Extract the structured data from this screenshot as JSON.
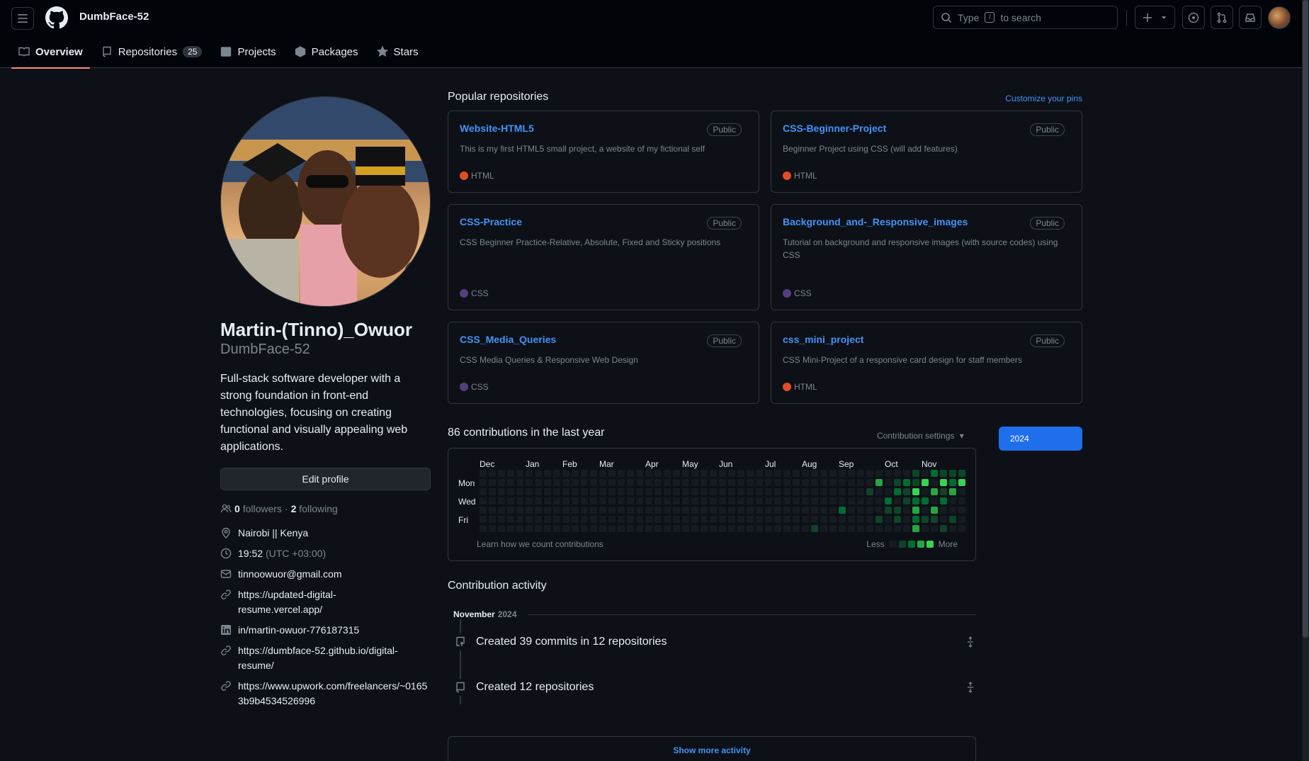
{
  "header": {
    "username": "DumbFace-52",
    "search_prefix": "Type",
    "search_key": "/",
    "search_suffix": "to search"
  },
  "tabs": [
    {
      "label": "Overview"
    },
    {
      "label": "Repositories",
      "count": "25"
    },
    {
      "label": "Projects"
    },
    {
      "label": "Packages"
    },
    {
      "label": "Stars"
    }
  ],
  "profile": {
    "fullname": "Martin-(Tinno)_Owuor",
    "login": "DumbFace-52",
    "bio": "Full-stack software developer with a strong foundation in front-end technologies, focusing on creating functional and visually appealing web applications.",
    "edit_label": "Edit profile",
    "followers_count": "0",
    "followers_label": "followers",
    "separator": "·",
    "following_count": "2",
    "following_label": "following",
    "location": "Nairobi || Kenya",
    "time": "19:52",
    "timezone": "(UTC +03:00)",
    "email": "tinnoowuor@gmail.com",
    "link1": "https://updated-digital-resume.vercel.app/",
    "linkedin": "in/martin-owuor-776187315",
    "link2": "https://dumbface-52.github.io/digital-resume/",
    "link3": "https://www.upwork.com/freelancers/~01653b9b4534526996"
  },
  "popular": {
    "title": "Popular repositories",
    "customize": "Customize your pins",
    "badge": "Public",
    "repos": [
      {
        "name": "Website-HTML5",
        "desc": "This is my first HTML5 small project, a website of my fictional self",
        "lang": "HTML",
        "color": "#e34c26"
      },
      {
        "name": "CSS-Beginner-Project",
        "desc": "Beginner Project using CSS (will add features)",
        "lang": "HTML",
        "color": "#e34c26"
      },
      {
        "name": "CSS-Practice",
        "desc": "CSS Beginner Practice-Relative, Absolute, Fixed and Sticky positions",
        "lang": "CSS",
        "color": "#563d7c"
      },
      {
        "name": "Background_and-_Responsive_images",
        "desc": "Tutorial on background and responsive images (with source codes) using CSS",
        "lang": "CSS",
        "color": "#563d7c"
      },
      {
        "name": "CSS_Media_Queries",
        "desc": "CSS Media Queries & Responsive Web Design",
        "lang": "CSS",
        "color": "#563d7c"
      },
      {
        "name": "css_mini_project",
        "desc": "CSS Mini-Project of a responsive card design for staff members",
        "lang": "HTML",
        "color": "#e34c26"
      }
    ]
  },
  "contributions": {
    "title": "86 contributions in the last year",
    "settings": "Contribution settings",
    "year": "2024",
    "months": [
      "Dec",
      "Jan",
      "Feb",
      "Mar",
      "Apr",
      "May",
      "Jun",
      "Jul",
      "Aug",
      "Sep",
      "Oct",
      "Nov"
    ],
    "days": [
      "Mon",
      "Wed",
      "Fri"
    ],
    "learn": "Learn how we count contributions",
    "less": "Less",
    "more": "More",
    "levels": [
      "#161b22",
      "#0e4429",
      "#006d32",
      "#26a641",
      "#39d353"
    ]
  },
  "activity": {
    "title": "Contribution activity",
    "month": "November",
    "year": "2024",
    "items": [
      {
        "text": "Created 39 commits in 12 repositories"
      },
      {
        "text": "Created 12 repositories"
      }
    ],
    "show_more": "Show more activity"
  }
}
